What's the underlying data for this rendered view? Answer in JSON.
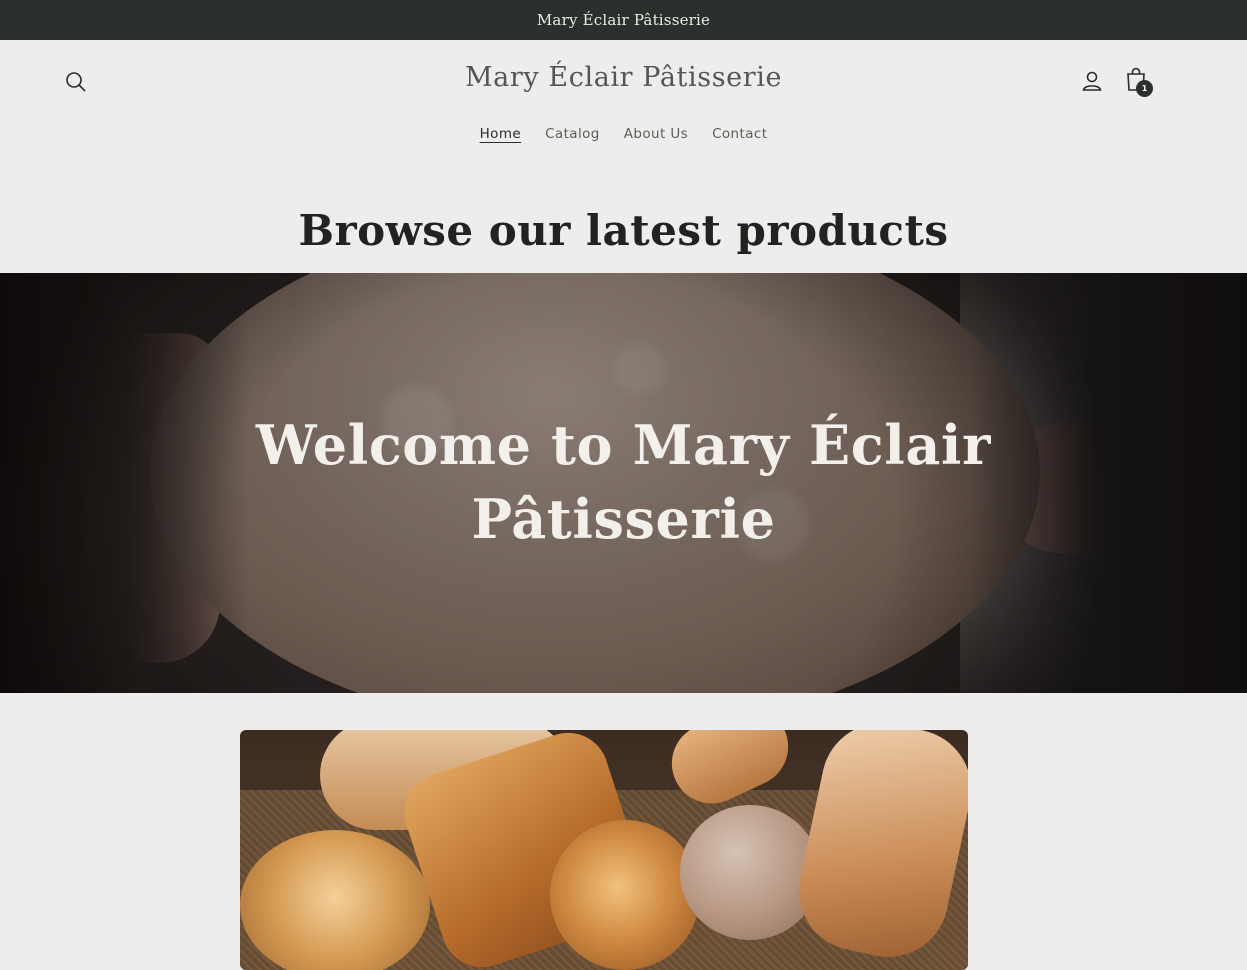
{
  "announcement": {
    "text": "Mary Éclair Pâtisserie"
  },
  "header": {
    "logo_text": "Mary Éclair Pâtisserie",
    "search_icon": "search-icon",
    "account_icon": "account-icon",
    "cart_icon": "cart-icon",
    "cart_count": "1"
  },
  "nav": {
    "items": [
      {
        "label": "Home",
        "active": true
      },
      {
        "label": "Catalog",
        "active": false
      },
      {
        "label": "About Us",
        "active": false
      },
      {
        "label": "Contact",
        "active": false
      }
    ]
  },
  "main": {
    "browse_title": "Browse our latest products",
    "hero_title_line1": "Welcome to Mary Éclair",
    "hero_title_line2": "Pâtisserie"
  },
  "colors": {
    "announcement_bg": "#2b302c",
    "page_bg": "#efedeb",
    "text_dark": "#222321"
  }
}
